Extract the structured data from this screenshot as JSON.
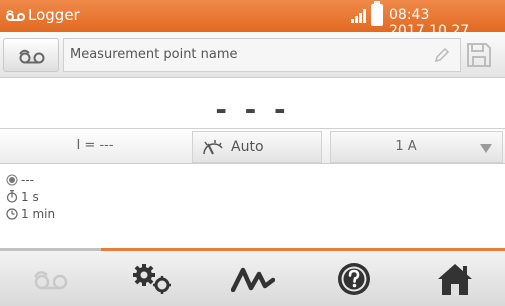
{
  "titlebar": {
    "title": "Logger",
    "clock": "08:43 2017.10.27",
    "accent_color": "#e8772f"
  },
  "namebar": {
    "placeholder": "Measurement point name",
    "icons": [
      "measurement-point-icon",
      "pencil-icon",
      "save-icon"
    ]
  },
  "readout": {
    "value": "- - -"
  },
  "params": {
    "current": "I = ---",
    "mode": "Auto",
    "range": "1 A"
  },
  "settings": {
    "status": "---",
    "interval": "1 s",
    "duration": "1 min"
  },
  "bottom_nav": [
    "logger-icon",
    "settings-gears-icon",
    "waveform-icon",
    "help-icon",
    "home-icon"
  ]
}
